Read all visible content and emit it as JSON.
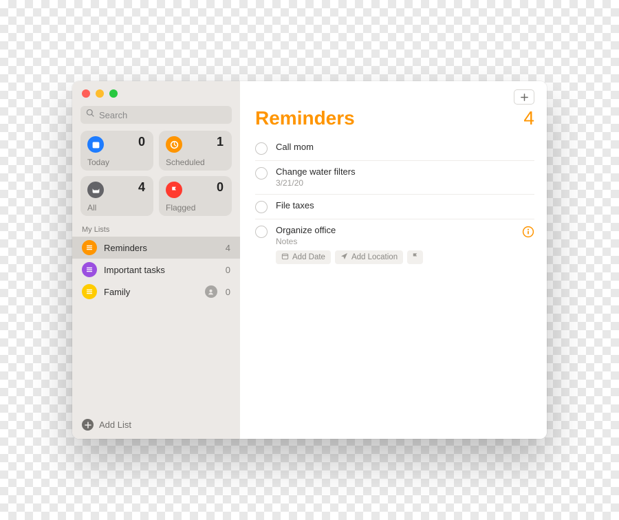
{
  "colors": {
    "accent": "#ff9500"
  },
  "sidebar": {
    "search_placeholder": "Search",
    "smart": [
      {
        "key": "today",
        "label": "Today",
        "count": 0,
        "color": "#1e7cff"
      },
      {
        "key": "scheduled",
        "label": "Scheduled",
        "count": 1,
        "color": "#ff9500"
      },
      {
        "key": "all",
        "label": "All",
        "count": 4,
        "color": "#646468"
      },
      {
        "key": "flagged",
        "label": "Flagged",
        "count": 0,
        "color": "#ff3b2f"
      }
    ],
    "section_label": "My Lists",
    "lists": [
      {
        "name": "Reminders",
        "count": 4,
        "color": "#ff9500",
        "selected": true,
        "shared": false
      },
      {
        "name": "Important tasks",
        "count": 0,
        "color": "#9b4fe0",
        "selected": false,
        "shared": false
      },
      {
        "name": "Family",
        "count": 0,
        "color": "#ffcc00",
        "selected": false,
        "shared": true
      }
    ],
    "add_list_label": "Add List"
  },
  "main": {
    "title": "Reminders",
    "count": 4,
    "items": [
      {
        "title": "Call mom"
      },
      {
        "title": "Change water filters",
        "date": "3/21/20"
      },
      {
        "title": "File taxes"
      },
      {
        "title": "Organize office",
        "notes_placeholder": "Notes",
        "editing": true,
        "chips": {
          "add_date": "Add Date",
          "add_location": "Add Location"
        }
      }
    ]
  }
}
